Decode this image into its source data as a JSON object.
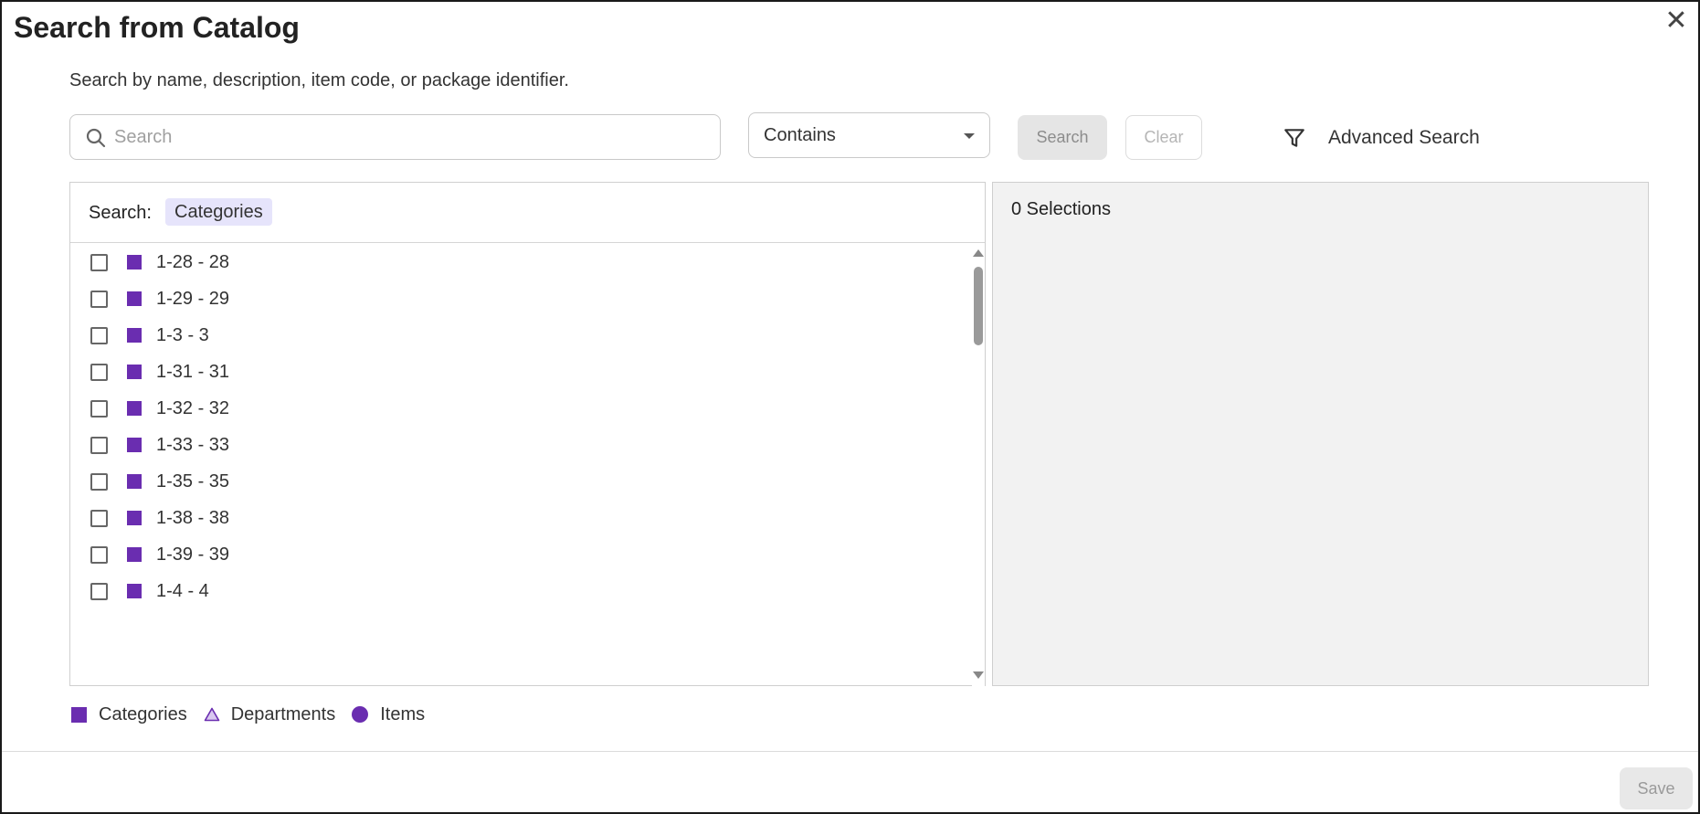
{
  "dialog": {
    "title": "Search from Catalog",
    "close_label": "✕",
    "subtitle": "Search by name, description, item code, or package identifier."
  },
  "search": {
    "placeholder": "Search",
    "value": "",
    "match_mode": "Contains",
    "search_button": "Search",
    "clear_button": "Clear",
    "advanced_label": "Advanced Search"
  },
  "left_panel": {
    "search_label": "Search:",
    "filter_chip": "Categories",
    "items": [
      {
        "label": "1-28 - 28"
      },
      {
        "label": "1-29 - 29"
      },
      {
        "label": "1-3 - 3"
      },
      {
        "label": "1-31 - 31"
      },
      {
        "label": "1-32 - 32"
      },
      {
        "label": "1-33 - 33"
      },
      {
        "label": "1-35 - 35"
      },
      {
        "label": "1-38 - 38"
      },
      {
        "label": "1-39 - 39"
      },
      {
        "label": "1-4 - 4"
      }
    ]
  },
  "right_panel": {
    "selections_label": "0 Selections"
  },
  "legend": {
    "categories": "Categories",
    "departments": "Departments",
    "items": "Items"
  },
  "footer": {
    "save_button": "Save"
  },
  "colors": {
    "accent": "#6a2db0",
    "chip_bg": "#e6e4fb",
    "panel_gray": "#f2f2f2"
  }
}
